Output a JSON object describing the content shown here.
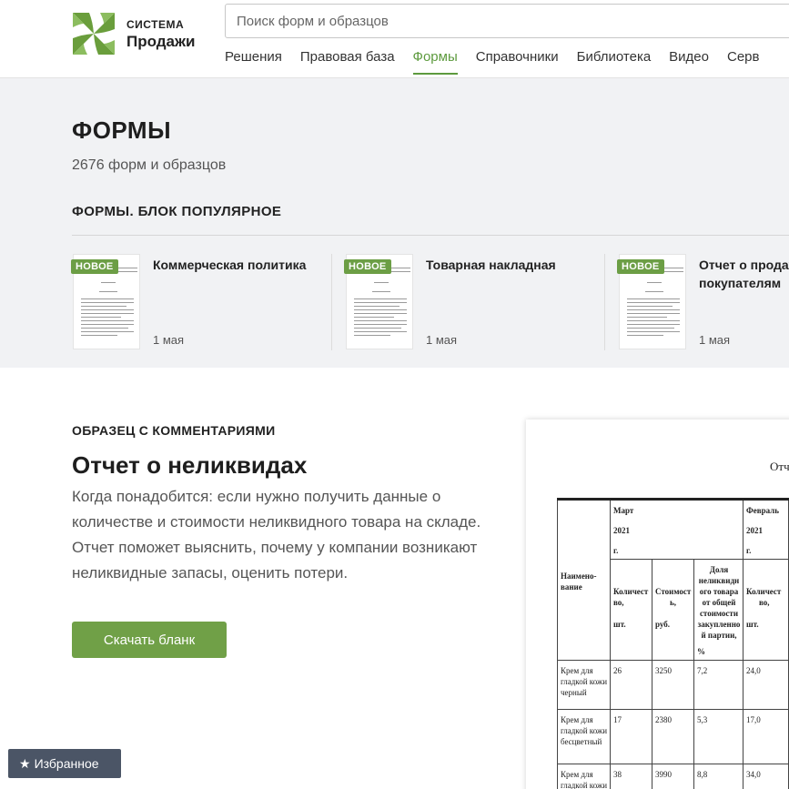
{
  "brand": {
    "top": "СИСТЕМА",
    "main": "Продажи",
    "color": "#6a9e3c"
  },
  "search": {
    "placeholder": "Поиск форм и образцов"
  },
  "nav": [
    "Решения",
    "Правовая база",
    "Формы",
    "Справочники",
    "Библиотека",
    "Видео",
    "Серв"
  ],
  "nav_active": "Формы",
  "page": {
    "title": "ФОРМЫ",
    "count": "2676 форм и образцов",
    "popular_label": "ФОРМЫ. БЛОК ПОПУЛЯРНОЕ"
  },
  "cards": [
    {
      "badge": "НОВОЕ",
      "title": "Коммерческая политика",
      "date": "1 мая"
    },
    {
      "badge": "НОВОЕ",
      "title": "Товарная накладная",
      "date": "1 мая"
    },
    {
      "badge": "НОВОЕ",
      "title": "Отчет о продажах по покупателям",
      "date": "1 мая"
    }
  ],
  "sample": {
    "label": "ОБРАЗЕЦ С КОММЕНТАРИЯМИ",
    "title": "Отчет о неликвидах",
    "description": "Когда понадобится: если нужно получить данные о количестве и стоимости неликвидного товара на складе. Отчет поможет выяснить, почему у компании возникают неликвидные запасы, оценить потери.",
    "button": "Скачать бланк"
  },
  "preview": {
    "heading": "Отч",
    "col_name": "Наимено-вание",
    "period1": [
      "Март",
      "2021",
      "г."
    ],
    "period2": [
      "Февраль",
      "2021",
      "г."
    ],
    "sub_qty": [
      "Количест",
      "во,",
      "шт."
    ],
    "sub_cost": [
      "Стоимост",
      "ь,",
      "руб."
    ],
    "sub_share": "Доля неликвидн ого товара от общей стоимости закупленно й партии,",
    "sub_share_unit": "%",
    "sub_qty2": [
      "Количест",
      "во,",
      "шт."
    ],
    "rows": [
      {
        "name": "Крем для гладкой кожи черный",
        "qty": "26",
        "cost": "3250",
        "share": "7,2",
        "qty2": "24,0"
      },
      {
        "name": "Крем для гладкой кожи бесцветный",
        "qty": "17",
        "cost": "2380",
        "share": "5,3",
        "qty2": "17,0"
      },
      {
        "name": "Крем для гладкой кожи",
        "qty": "38",
        "cost": "3990",
        "share": "8,8",
        "qty2": "34,0"
      }
    ]
  },
  "favorites": {
    "label": "Избранное",
    "icon": "star-icon"
  }
}
